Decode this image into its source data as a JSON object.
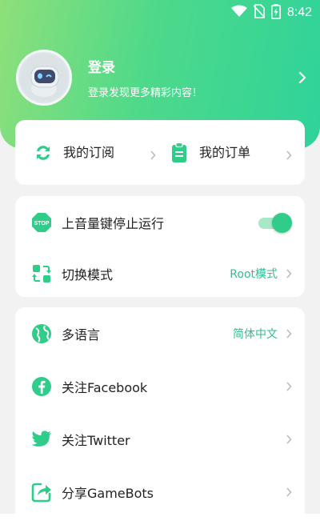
{
  "status_bar": {
    "time": "8:42"
  },
  "profile": {
    "title": "登录",
    "subtitle": "登录发现更多精彩内容！"
  },
  "quick_links": [
    {
      "label": "我的订阅",
      "icon": "refresh-icon"
    },
    {
      "label": "我的订单",
      "icon": "clipboard-icon"
    }
  ],
  "settings": {
    "volume_stop": {
      "label": "上音量键停止运行",
      "icon": "stop-icon",
      "enabled": true
    },
    "switch_mode": {
      "label": "切换模式",
      "value": "Root模式",
      "icon": "switch-icon"
    }
  },
  "more": [
    {
      "label": "多语言",
      "value": "简体中文",
      "icon": "globe-icon"
    },
    {
      "label": "关注Facebook",
      "value": "",
      "icon": "facebook-icon"
    },
    {
      "label": "关注Twitter",
      "value": "",
      "icon": "twitter-icon"
    },
    {
      "label": "分享GameBots",
      "value": "",
      "icon": "share-icon"
    }
  ],
  "colors": {
    "accent": "#2fcc8a",
    "value_text": "#2fbf90"
  }
}
